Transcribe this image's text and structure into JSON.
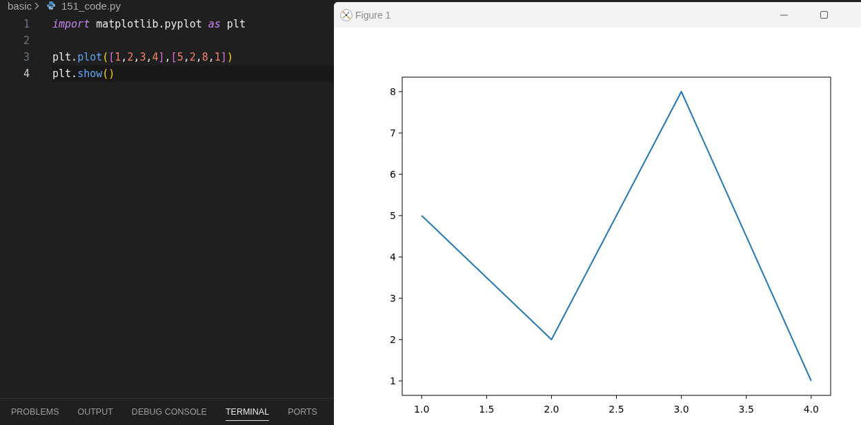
{
  "editor": {
    "breadcrumb": {
      "folder": "basic",
      "file": "151_code.py"
    },
    "lines": [
      {
        "number": "1",
        "current": false,
        "tokens": [
          {
            "text": "import",
            "kind": "keyword"
          },
          {
            "text": " matplotlib.pyplot ",
            "kind": "plain"
          },
          {
            "text": "as",
            "kind": "keyword"
          },
          {
            "text": " plt",
            "kind": "plain"
          }
        ]
      },
      {
        "number": "2",
        "current": false
      },
      {
        "number": "3",
        "current": false,
        "tokens": [
          {
            "text": "plt.",
            "kind": "plain"
          },
          {
            "text": "plot",
            "kind": "function"
          },
          {
            "text": "(",
            "kind": "paren"
          },
          {
            "text": "[",
            "kind": "bracket"
          },
          {
            "text": "1",
            "kind": "number"
          },
          {
            "text": ",",
            "kind": "plain"
          },
          {
            "text": "2",
            "kind": "number"
          },
          {
            "text": ",",
            "kind": "plain"
          },
          {
            "text": "3",
            "kind": "number"
          },
          {
            "text": ",",
            "kind": "plain"
          },
          {
            "text": "4",
            "kind": "number"
          },
          {
            "text": "]",
            "kind": "bracket"
          },
          {
            "text": ",",
            "kind": "plain"
          },
          {
            "text": "[",
            "kind": "bracket"
          },
          {
            "text": "5",
            "kind": "number"
          },
          {
            "text": ",",
            "kind": "plain"
          },
          {
            "text": "2",
            "kind": "number"
          },
          {
            "text": ",",
            "kind": "plain"
          },
          {
            "text": "8",
            "kind": "number"
          },
          {
            "text": ",",
            "kind": "plain"
          },
          {
            "text": "1",
            "kind": "number"
          },
          {
            "text": "]",
            "kind": "bracket"
          },
          {
            "text": ")",
            "kind": "paren"
          }
        ]
      },
      {
        "number": "4",
        "current": true,
        "tokens": [
          {
            "text": "plt.",
            "kind": "plain"
          },
          {
            "text": "show",
            "kind": "function"
          },
          {
            "text": "()",
            "kind": "paren"
          }
        ]
      }
    ]
  },
  "panel": {
    "tabs": [
      {
        "label": "PROBLEMS",
        "selected": false
      },
      {
        "label": "OUTPUT",
        "selected": false
      },
      {
        "label": "DEBUG CONSOLE",
        "selected": false
      },
      {
        "label": "TERMINAL",
        "selected": true
      },
      {
        "label": "PORTS",
        "selected": false
      }
    ]
  },
  "figure_window": {
    "title": "Figure 1",
    "chart_data": {
      "type": "line",
      "x": [
        1,
        2,
        3,
        4
      ],
      "series": [
        {
          "color": "#1f77b4",
          "values": [
            5,
            2,
            8,
            1
          ]
        }
      ],
      "xlim": [
        0.85,
        4.15
      ],
      "ylim": [
        0.65,
        8.35
      ],
      "xticks": [
        {
          "value": 1,
          "label": "1.0"
        },
        {
          "value": 1.5,
          "label": "1.5"
        },
        {
          "value": 2,
          "label": "2.0"
        },
        {
          "value": 2.5,
          "label": "2.5"
        },
        {
          "value": 3,
          "label": "3.0"
        },
        {
          "value": 3.5,
          "label": "3.5"
        },
        {
          "value": 4,
          "label": "4.0"
        }
      ],
      "yticks": [
        1,
        2,
        3,
        4,
        5,
        6,
        7,
        8
      ]
    }
  }
}
